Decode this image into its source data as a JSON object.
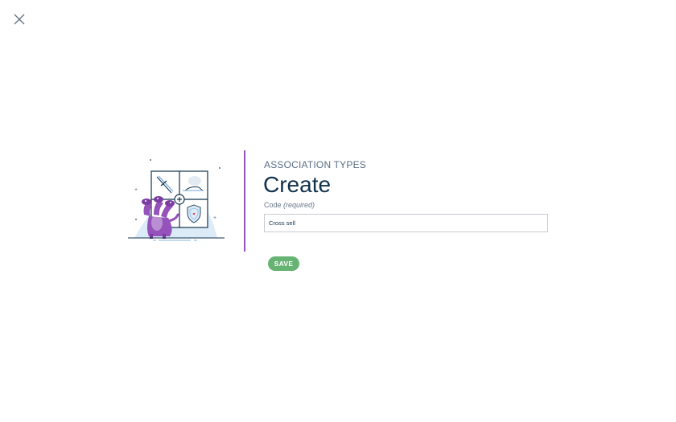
{
  "header": {
    "close_icon": "close-icon"
  },
  "illustration": {
    "icon": "association-types-illustration",
    "accent_color": "#9452ba"
  },
  "form": {
    "breadcrumb": "ASSOCIATION TYPES",
    "title": "Create",
    "code_label": "Code",
    "code_required": "(required)",
    "code_value": "Cross sell",
    "save_label": "SAVE"
  },
  "colors": {
    "accent": "#9452ba",
    "save_button": "#67b373",
    "text": "#11324d"
  }
}
